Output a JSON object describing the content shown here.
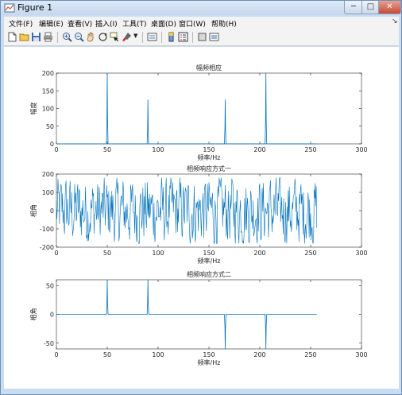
{
  "window": {
    "title": "Figure 1"
  },
  "window_buttons": {
    "minimize": "─",
    "maximize": "□",
    "close": "✕"
  },
  "menu": [
    "文件(F)",
    "编辑(E)",
    "查看(V)",
    "插入(I)",
    "工具(T)",
    "桌面(D)",
    "窗口(W)",
    "帮助(H)"
  ],
  "toolbar_icons": [
    "new-figure-icon",
    "open-file-icon",
    "save-icon",
    "print-icon",
    "zoom-in-icon",
    "zoom-out-icon",
    "pan-icon",
    "rotate-3d-icon",
    "data-cursor-icon",
    "brush-icon",
    "brush-dropdown-icon",
    "link-plot-icon",
    "insert-colorbar-icon",
    "insert-legend-icon",
    "hide-plot-tools-icon",
    "show-plot-tools-icon"
  ],
  "colors": {
    "line": "#0072bd",
    "axes": "#262626",
    "window_frame": "#c9dcf0"
  },
  "chart_data": [
    {
      "type": "line",
      "title": "幅频相应",
      "xlabel": "频率/Hz",
      "ylabel": "幅度",
      "xlim": [
        0,
        300
      ],
      "ylim": [
        0,
        200
      ],
      "xticks": [
        0,
        50,
        100,
        150,
        200,
        250,
        300
      ],
      "yticks": [
        0,
        50,
        100,
        150,
        200
      ],
      "description_of_series": "spectrum magnitude with spikes",
      "peaks": [
        {
          "x": 50,
          "y": 200
        },
        {
          "x": 90,
          "y": 125
        },
        {
          "x": 166,
          "y": 125
        },
        {
          "x": 206,
          "y": 200
        }
      ],
      "baseline": 0,
      "x_end": 256
    },
    {
      "type": "line",
      "title": "相频响应方式一",
      "xlabel": "频率/Hz",
      "ylabel": "相角",
      "xlim": [
        0,
        300
      ],
      "ylim": [
        -200,
        200
      ],
      "xticks": [
        0,
        50,
        100,
        150,
        200,
        250,
        300
      ],
      "yticks": [
        -200,
        -100,
        0,
        100,
        200
      ],
      "x_end": 256,
      "value_range": [
        -180,
        180
      ],
      "approx_points": 512
    },
    {
      "type": "line",
      "title": "相频响应方式二",
      "xlabel": "频率/Hz",
      "ylabel": "相角",
      "xlim": [
        0,
        300
      ],
      "ylim": [
        -60,
        60
      ],
      "xticks": [
        0,
        50,
        100,
        150,
        200,
        250,
        300
      ],
      "yticks": [
        -50,
        0,
        50
      ],
      "peaks": [
        {
          "x": 50,
          "y": 60
        },
        {
          "x": 90,
          "y": 60
        },
        {
          "x": 166,
          "y": -60
        },
        {
          "x": 206,
          "y": -60
        }
      ],
      "baseline": 0,
      "x_end": 256
    }
  ]
}
